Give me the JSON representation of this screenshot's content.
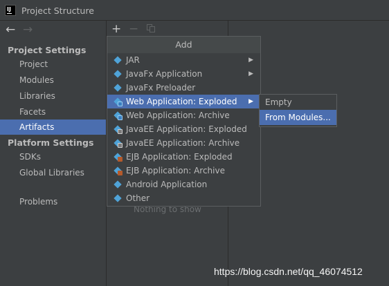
{
  "window": {
    "title": "Project Structure",
    "icon": "intellij-icon"
  },
  "nav": {
    "back": "←",
    "forward": "→"
  },
  "sidebar": {
    "project_settings_title": "Project Settings",
    "project_settings_items": [
      "Project",
      "Modules",
      "Libraries",
      "Facets",
      "Artifacts"
    ],
    "platform_settings_title": "Platform Settings",
    "platform_settings_items": [
      "SDKs",
      "Global Libraries"
    ],
    "problems": "Problems",
    "selected": "Artifacts"
  },
  "toolbar": {
    "add": "+",
    "remove": "−",
    "copy_icon": "copy-icon"
  },
  "middle": {
    "empty_text": "Nothing to show"
  },
  "add_popup": {
    "header": "Add",
    "items": [
      {
        "label": "JAR",
        "icon": "jar-icon",
        "has_submenu": true
      },
      {
        "label": "JavaFx Application",
        "icon": "javafx-icon",
        "has_submenu": true
      },
      {
        "label": "JavaFx Preloader",
        "icon": "javafx-icon",
        "has_submenu": false
      },
      {
        "label": "Web Application: Exploded",
        "icon": "web-exploded-icon",
        "has_submenu": true,
        "selected": true
      },
      {
        "label": "Web Application: Archive",
        "icon": "web-archive-icon",
        "has_submenu": false
      },
      {
        "label": "JavaEE Application: Exploded",
        "icon": "javaee-exploded-icon",
        "has_submenu": false
      },
      {
        "label": "JavaEE Application: Archive",
        "icon": "javaee-archive-icon",
        "has_submenu": false
      },
      {
        "label": "EJB Application: Exploded",
        "icon": "ejb-exploded-icon",
        "has_submenu": false
      },
      {
        "label": "EJB Application: Archive",
        "icon": "ejb-archive-icon",
        "has_submenu": false
      },
      {
        "label": "Android Application",
        "icon": "android-icon",
        "has_submenu": false
      },
      {
        "label": "Other",
        "icon": "other-icon",
        "has_submenu": false
      }
    ],
    "submenu_arrow": "▶"
  },
  "submenu": {
    "items": [
      "Empty",
      "From Modules..."
    ],
    "selected": "From Modules..."
  },
  "watermark": "https://blog.csdn.net/qq_46074512",
  "colors": {
    "background": "#3c3f41",
    "selection": "#4b6eaf",
    "text": "#bbbbbb",
    "icon_blue": "#4fa3d8"
  }
}
